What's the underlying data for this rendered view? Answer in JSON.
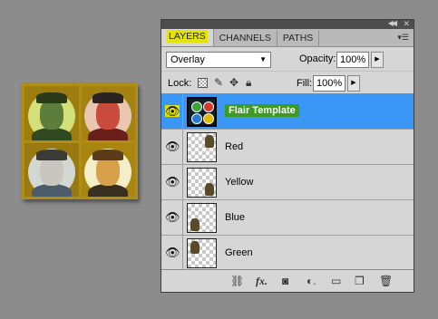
{
  "preview": {
    "quadrants": [
      {
        "name": "green",
        "bg": "#9d7d10",
        "ring": "#d3e07a",
        "face": "#5c7d3b",
        "hat": "#2b3a1b",
        "body": "#2f4a22"
      },
      {
        "name": "red",
        "bg": "#a38212",
        "ring": "#e8c6b0",
        "face": "#c94b3b",
        "hat": "#2a2420",
        "body": "#6a1f1a"
      },
      {
        "name": "blue",
        "bg": "#9a7a10",
        "ring": "#d4d8d2",
        "face": "#c9c7bd",
        "hat": "#3b3a35",
        "body": "#4b5b6a"
      },
      {
        "name": "yellow",
        "bg": "#a9860f",
        "ring": "#f4efc8",
        "face": "#d7a14a",
        "hat": "#5a3d18",
        "body": "#3a3020"
      }
    ]
  },
  "panel": {
    "tabs": [
      {
        "label": "LAYERS",
        "active": true
      },
      {
        "label": "CHANNELS",
        "active": false
      },
      {
        "label": "PATHS",
        "active": false
      }
    ],
    "blend_mode": "Overlay",
    "opacity_label": "Opacity:",
    "opacity_value": "100%",
    "lock_label": "Lock:",
    "fill_label": "Fill:",
    "fill_value": "100%"
  },
  "layers": [
    {
      "name": "Flair Template",
      "selected": true,
      "visible": true,
      "thumb": "template"
    },
    {
      "name": "Red",
      "selected": false,
      "visible": true,
      "thumb": "figure"
    },
    {
      "name": "Yellow",
      "selected": false,
      "visible": true,
      "thumb": "figure"
    },
    {
      "name": "Blue",
      "selected": false,
      "visible": true,
      "thumb": "figure"
    },
    {
      "name": "Green",
      "selected": false,
      "visible": true,
      "thumb": "figure"
    }
  ],
  "colors": {
    "selection": "#3b97f5",
    "highlight_yellow": "#e1e000",
    "name_badge_green": "#3d9b23"
  },
  "template_dots": [
    "#3aa43a",
    "#d23a2a",
    "#2a7ad2",
    "#e6b800"
  ],
  "icons": {
    "eye": "eye-icon",
    "bottom": [
      "link-layers-icon",
      "fx-icon",
      "add-mask-icon",
      "adjustment-layer-icon",
      "new-group-icon",
      "new-layer-icon",
      "trash-icon"
    ]
  }
}
